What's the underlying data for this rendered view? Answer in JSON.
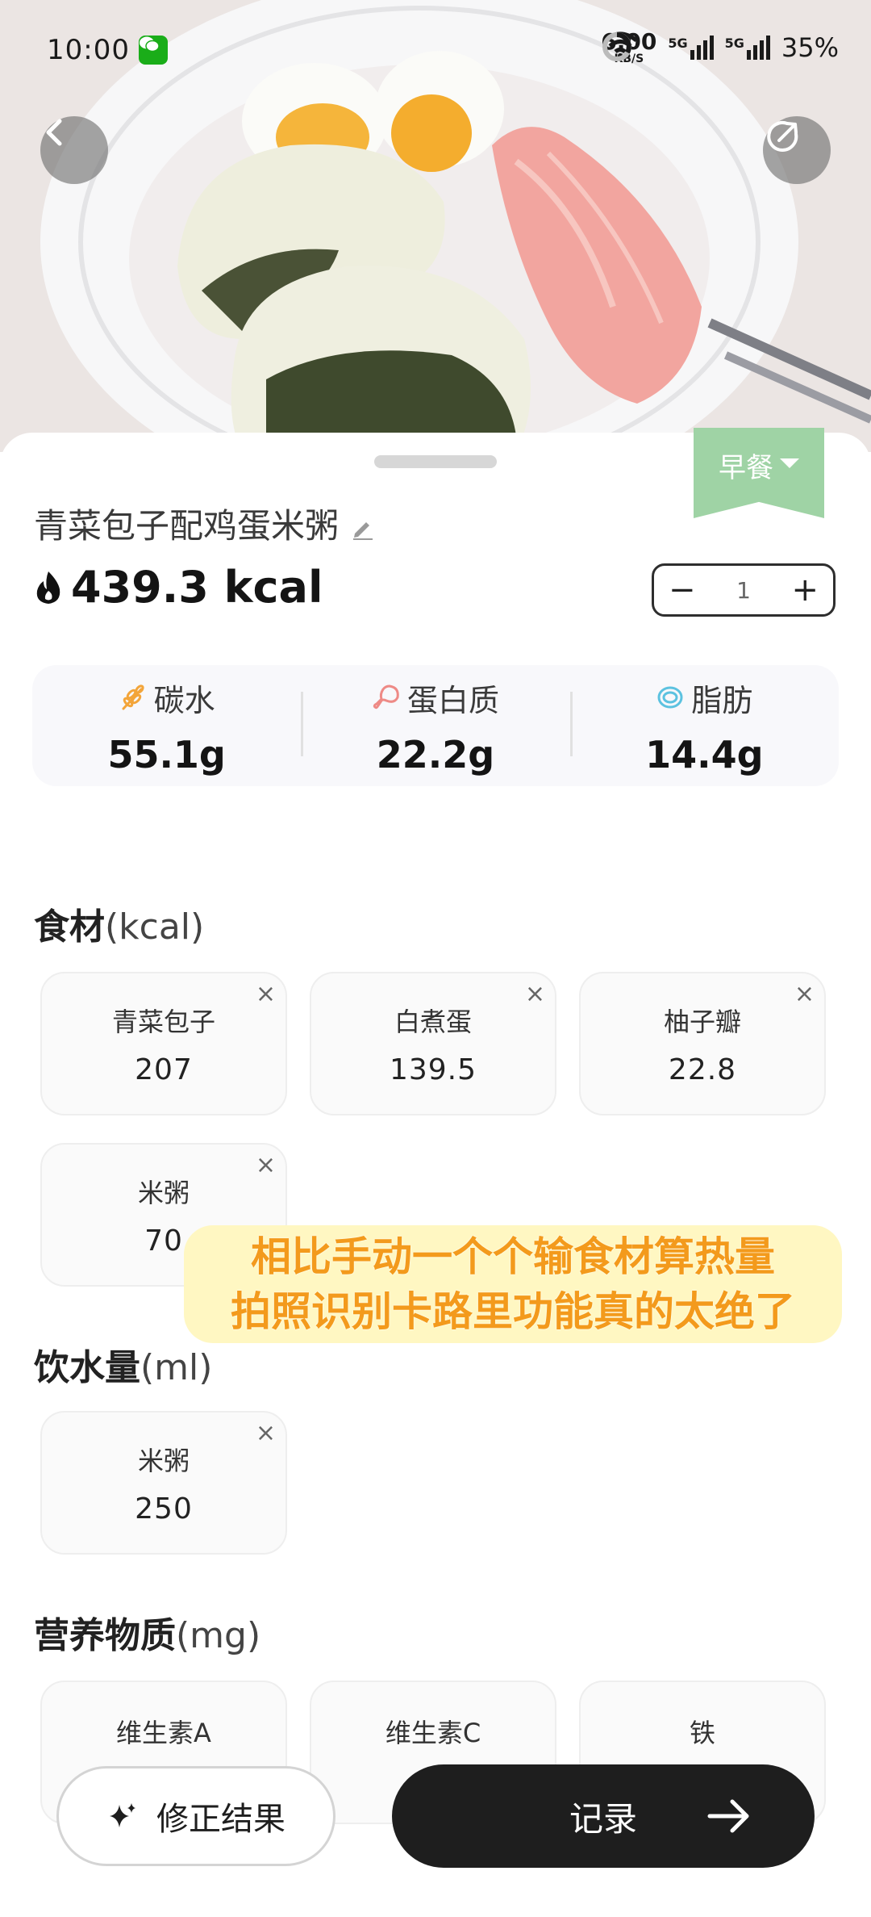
{
  "status_bar": {
    "time": "10:00",
    "net_speed": "6.00",
    "net_unit": "KB/S",
    "battery": "35%",
    "signal_1": "5G",
    "signal_2": "5G"
  },
  "meal_tag": "早餐",
  "dish_title": "青菜包子配鸡蛋米粥",
  "calories": "439.3 kcal",
  "portion_count": "1",
  "macros": [
    {
      "label": "碳水",
      "value": "55.1g",
      "icon": "wheat-icon"
    },
    {
      "label": "蛋白质",
      "value": "22.2g",
      "icon": "drumstick-icon"
    },
    {
      "label": "脂肪",
      "value": "14.4g",
      "icon": "fat-drop-icon"
    }
  ],
  "ingredients": {
    "title": "食材",
    "unit": "(kcal)",
    "items": [
      {
        "name": "青菜包子",
        "value": "207"
      },
      {
        "name": "白煮蛋",
        "value": "139.5"
      },
      {
        "name": "柚子瓣",
        "value": "22.8"
      },
      {
        "name": "米粥",
        "value": "70"
      }
    ]
  },
  "water": {
    "title": "饮水量",
    "unit": "(ml)",
    "items": [
      {
        "name": "米粥",
        "value": "250"
      }
    ]
  },
  "nutrients": {
    "title": "营养物质",
    "unit": "(mg)",
    "items": [
      {
        "name": "维生素A"
      },
      {
        "name": "维生素C"
      },
      {
        "name": "铁"
      }
    ]
  },
  "overlay_caption": {
    "line1": "相比手动一个个输食材算热量",
    "line2": "拍照识别卡路里功能真的太绝了"
  },
  "buttons": {
    "fix": "修正结果",
    "record": "记录"
  },
  "colors": {
    "meal_tag": "#9fd3a5",
    "record_button": "#1e1e1e",
    "caption_text": "#f39a1c",
    "caption_bg": "#fff7c2"
  }
}
